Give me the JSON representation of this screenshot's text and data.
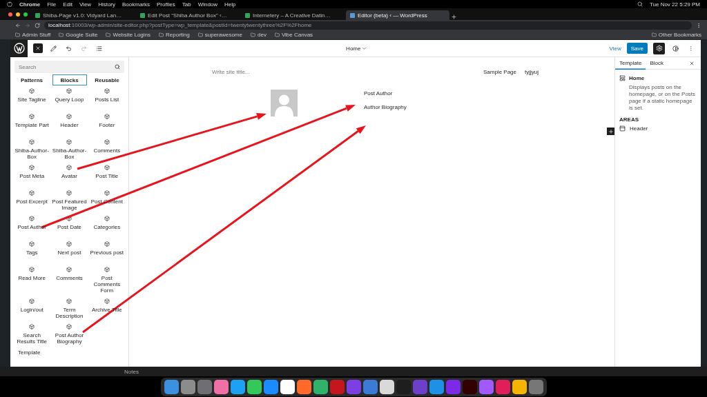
{
  "menu_bar": {
    "items": [
      "Chrome",
      "File",
      "Edit",
      "View",
      "History",
      "Bookmarks",
      "Profiles",
      "Tab",
      "Window",
      "Help"
    ],
    "clock": "Tue Nov 22  5:29 PM"
  },
  "browser_tabs": [
    {
      "title": "Shiba-Page v1.0: Vidyard Lan…",
      "selected": false
    },
    {
      "title": "Edit Post \"Shiba Author Box\" ‹…",
      "selected": false
    },
    {
      "title": "Internetery – A Creative Datin…",
      "selected": false
    },
    {
      "title": "Editor (beta) ‹ — WordPress",
      "selected": true
    }
  ],
  "address_bar": {
    "host": "localhost",
    "path": ":10003/wp-admin/site-editor.php?postType=wp_template&postId=twentytwentythree%2F%2Fhome"
  },
  "bookmarks": {
    "items": [
      "Admin Stuff",
      "Google Suite",
      "Website Logins",
      "Reporting",
      "superawesome",
      "dev",
      "Vibe Canvas"
    ],
    "other": "Other Bookmarks"
  },
  "editor_toolbar": {
    "template": "Home",
    "view": "View",
    "save": "Save",
    "settings_active": true
  },
  "inserter": {
    "search_placeholder": "Search",
    "tabs": [
      {
        "label": "Patterns",
        "selected": false
      },
      {
        "label": "Blocks",
        "selected": true
      },
      {
        "label": "Reusable",
        "selected": false
      }
    ],
    "blocks": [
      {
        "label": "Site Tagline"
      },
      {
        "label": "Query Loop"
      },
      {
        "label": "Posts List"
      },
      {
        "label": "Template Part"
      },
      {
        "label": "Header"
      },
      {
        "label": "Footer"
      },
      {
        "label": "Shiba-Author-Box"
      },
      {
        "label": "Shiba-Author-Box"
      },
      {
        "label": "Comments"
      },
      {
        "label": "Post Meta"
      },
      {
        "label": "Avatar"
      },
      {
        "label": "Post Title"
      },
      {
        "label": "Post Excerpt"
      },
      {
        "label": "Post Featured Image"
      },
      {
        "label": "Post Content"
      },
      {
        "label": "Post Author"
      },
      {
        "label": "Post Date"
      },
      {
        "label": "Categories"
      },
      {
        "label": "Tags"
      },
      {
        "label": "Next post"
      },
      {
        "label": "Previous post"
      },
      {
        "label": "Read More"
      },
      {
        "label": "Comments"
      },
      {
        "label": "Post Comments Form"
      },
      {
        "label": "Login/out"
      },
      {
        "label": "Term Description"
      },
      {
        "label": "Archive Title"
      },
      {
        "label": "Search Results Title"
      },
      {
        "label": "Post Author Biography"
      }
    ],
    "section": "Template"
  },
  "canvas": {
    "site_title_placeholder": "Write site title...",
    "nav": [
      "Sample Page",
      "tyjjyuj"
    ],
    "post_author": "Post Author",
    "author_biography": "Author Biography"
  },
  "sidebar": {
    "tabs": [
      {
        "label": "Template",
        "selected": true
      },
      {
        "label": "Block",
        "selected": false
      }
    ],
    "template_name": "Home",
    "description": "Displays posts on the homepage, or on the Posts page if a static homepage is set.",
    "areas_heading": "AREAS",
    "areas": [
      "Header"
    ]
  },
  "notes": "Notes",
  "dock": [
    {
      "color": "#3d8fe0"
    },
    {
      "color": "#8c8c8c"
    },
    {
      "color": "#6e6e73"
    },
    {
      "color": "#f06fa5"
    },
    {
      "color": "#1da1f2"
    },
    {
      "color": "#34c759"
    },
    {
      "color": "#1a8cff"
    },
    {
      "color": "#ffffff"
    },
    {
      "color": "#ff6a2b"
    },
    {
      "color": "#2fb36b"
    },
    {
      "color": "#c4161c"
    },
    {
      "color": "#7b3fe4"
    },
    {
      "color": "#3a7bd5"
    },
    {
      "color": "#d9d9d9"
    },
    {
      "color": "#1e1e1e"
    },
    {
      "color": "#6e40c9"
    },
    {
      "color": "#1d91e6"
    },
    {
      "color": "#7d2ae8"
    },
    {
      "color": "#330000"
    },
    {
      "color": "#a259ff"
    },
    {
      "color": "#e01e5a"
    },
    {
      "color": "#f4b400"
    },
    {
      "color": "#777777"
    }
  ]
}
